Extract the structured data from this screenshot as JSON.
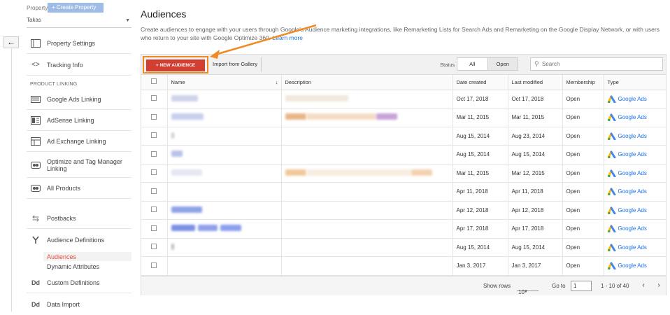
{
  "sidebar": {
    "property_label": "Property",
    "create_property": "+ Create Property",
    "property_value": "Takas",
    "items": [
      {
        "label": "Property Settings"
      },
      {
        "label": "Tracking Info"
      },
      {
        "label": "Google Ads Linking"
      },
      {
        "label": "AdSense Linking"
      },
      {
        "label": "Ad Exchange Linking"
      },
      {
        "label": "Optimize and Tag Manager Linking"
      },
      {
        "label": "All Products"
      },
      {
        "label": "Postbacks"
      },
      {
        "label": "Audience Definitions"
      },
      {
        "label": "Custom Definitions"
      },
      {
        "label": "Data Import"
      }
    ],
    "section_product_linking": "PRODUCT LINKING",
    "sub_items": [
      {
        "label": "Audiences"
      },
      {
        "label": "Dynamic Attributes"
      }
    ]
  },
  "header": {
    "title": "Audiences",
    "description": "Create audiences to engage with your users through Google's Audience marketing integrations, like Remarketing Lists for Search Ads and Remarketing on the Google Display Network, or with users who return to your site with Google Optimize 360.",
    "learn_more": "Learn more"
  },
  "toolbar": {
    "new_audience": "+ NEW AUDIENCE",
    "import_gallery": "Import from Gallery",
    "status_label": "Status",
    "status_all": "All",
    "status_open": "Open",
    "search_placeholder": "Search"
  },
  "table": {
    "columns": [
      "Name",
      "Description",
      "Date created",
      "Last modified",
      "Membership",
      "Type"
    ],
    "rows": [
      {
        "created": "Oct 17, 2018",
        "modified": "Oct 17, 2018",
        "membership": "Open",
        "type": "Google Ads"
      },
      {
        "created": "Mar 11, 2015",
        "modified": "Mar 11, 2015",
        "membership": "Open",
        "type": "Google Ads"
      },
      {
        "created": "Aug 15, 2014",
        "modified": "Aug 23, 2014",
        "membership": "Open",
        "type": "Google Ads"
      },
      {
        "created": "Aug 15, 2014",
        "modified": "Aug 15, 2014",
        "membership": "Open",
        "type": "Google Ads"
      },
      {
        "created": "Mar 11, 2015",
        "modified": "Mar 12, 2015",
        "membership": "Open",
        "type": "Google Ads"
      },
      {
        "created": "Apr 11, 2018",
        "modified": "Apr 11, 2018",
        "membership": "Open",
        "type": "Google Ads"
      },
      {
        "created": "Apr 12, 2018",
        "modified": "Apr 12, 2018",
        "membership": "Open",
        "type": "Google Ads"
      },
      {
        "created": "Apr 17, 2018",
        "modified": "Apr 17, 2018",
        "membership": "Open",
        "type": "Google Ads"
      },
      {
        "created": "Aug 15, 2014",
        "modified": "Aug 15, 2014",
        "membership": "Open",
        "type": "Google Ads"
      },
      {
        "created": "Jan 3, 2017",
        "modified": "Jan 3, 2017",
        "membership": "Open",
        "type": "Google Ads"
      }
    ]
  },
  "footer": {
    "show_rows_label": "Show rows",
    "rows_value": "10",
    "goto_label": "Go to",
    "goto_value": "1",
    "range": "1 - 10 of 40"
  },
  "colors": {
    "accent_red": "#d23f31",
    "highlight_orange": "#f08a24",
    "link_blue": "#1a73e8"
  }
}
